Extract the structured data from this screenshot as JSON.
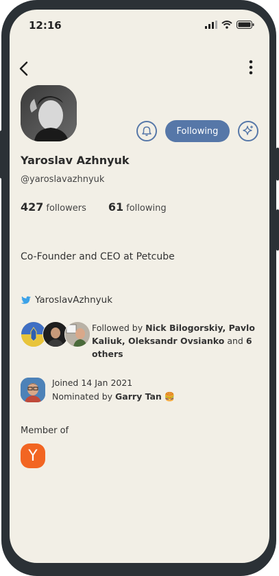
{
  "status": {
    "time": "12:16"
  },
  "actions": {
    "following_label": "Following"
  },
  "profile": {
    "name": "Yaroslav Azhnyuk",
    "handle": "@yaroslavazhnyuk",
    "followers_count": "427",
    "followers_label": "followers",
    "following_count": "61",
    "following_label": "following",
    "bio": "Co-Founder and CEO at Petcube",
    "twitter": "YaroslavAzhnyuk"
  },
  "followed_by": {
    "prefix": "Followed by ",
    "names": "Nick Bilogorskiy, Pavlo Kaliuk, Oleksandr Ovsianko",
    "and": " and ",
    "others": "6 others"
  },
  "joined": {
    "date_text": "Joined 14 Jan 2021",
    "nominated_prefix": "Nominated by ",
    "nominator": "Garry Tan",
    "emoji": "🍔"
  },
  "member_of": {
    "label": "Member of",
    "club_letter": "Y"
  },
  "colors": {
    "background": "#f2efe6",
    "accent": "#5677a8",
    "yc": "#f26522"
  }
}
